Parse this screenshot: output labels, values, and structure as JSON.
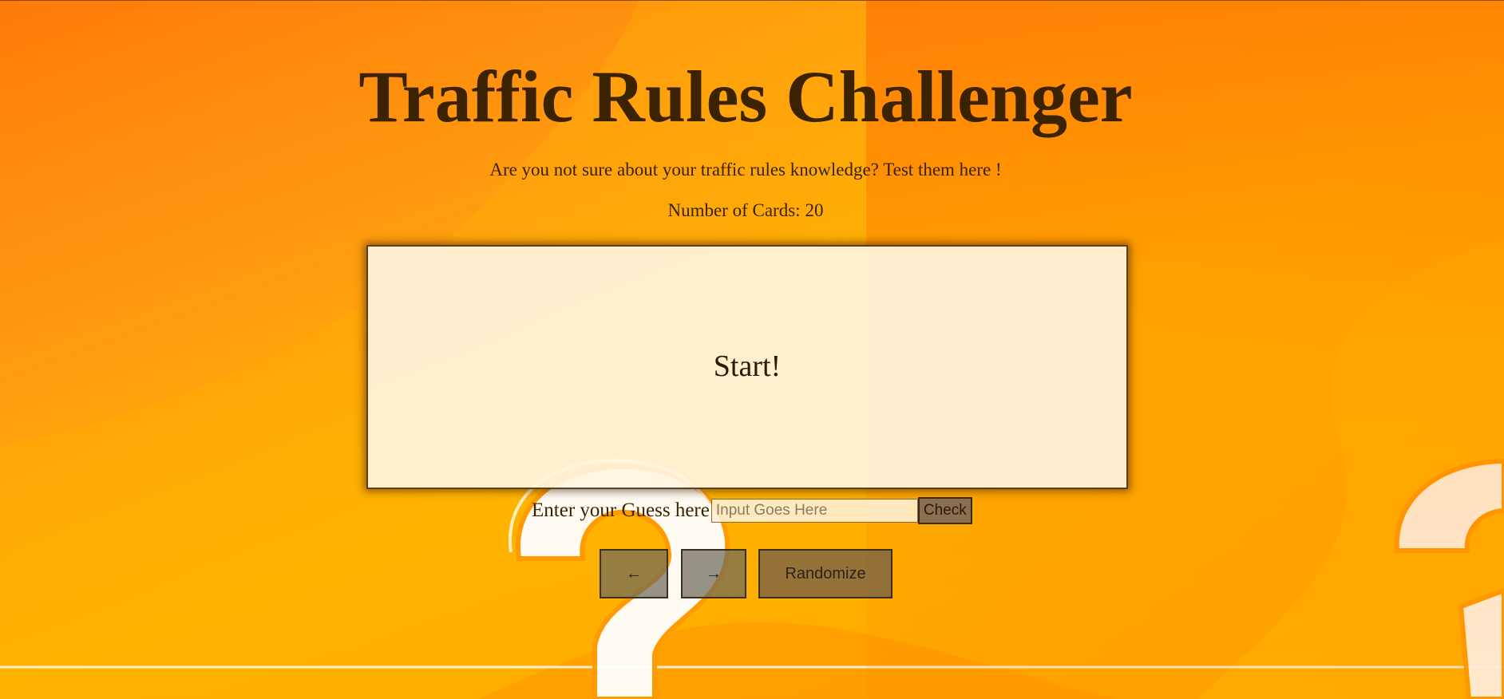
{
  "header": {
    "title": "Traffic Rules Challenger",
    "subtitle": "Are you not sure about your traffic rules knowledge? Test them here !",
    "card_count_label": "Number of Cards:",
    "card_count": "20"
  },
  "flashcard": {
    "text": "Start!"
  },
  "guess": {
    "label": "Enter your Guess here",
    "placeholder": "Input Goes Here",
    "value": "",
    "check_label": "Check"
  },
  "navigation": {
    "prev_label": "←",
    "next_label": "→",
    "randomize_label": "Randomize"
  },
  "colors": {
    "background_primary": "#ff9a10",
    "background_secondary": "#ffb400",
    "title_text": "#3b2200",
    "card_background": "#fff4de"
  },
  "background_decoration": {
    "icons": [
      "question-mark-icon",
      "question-mark-icon"
    ]
  }
}
